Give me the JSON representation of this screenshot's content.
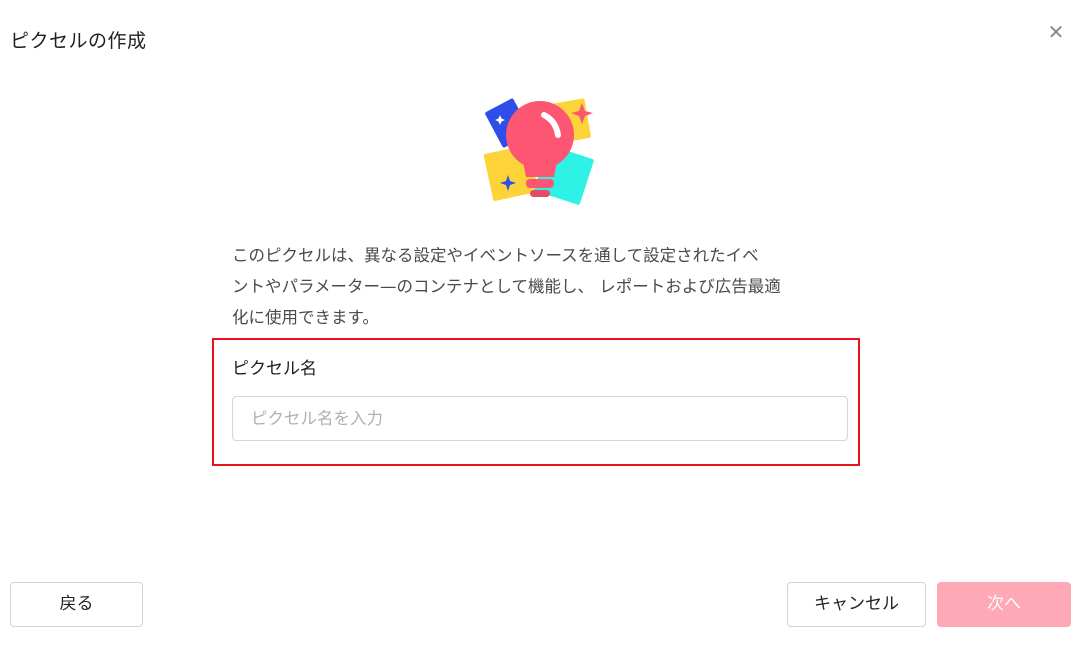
{
  "dialog": {
    "title": "ピクセルの作成",
    "close_icon": "close-icon"
  },
  "illustration": {
    "icon": "lightbulb-illustration",
    "colors": {
      "bulb": "#fd5672",
      "blue_card": "#2f4ee8",
      "yellow_card": "#fdd33a",
      "cyan_card": "#2ff2e6",
      "star": "#fd5672"
    }
  },
  "description": {
    "line1": "このピクセルは、異なる設定やイベントソースを通して設定されたイベ",
    "line2": "ントやパラメーター—のコンテナとして機能し、 レポートおよび広告最適",
    "line3": "化に使用できます。"
  },
  "form": {
    "label": "ピクセル名",
    "input_value": "",
    "input_placeholder": "ピクセル名を入力"
  },
  "footer": {
    "back_label": "戻る",
    "cancel_label": "キャンセル",
    "next_label": "次へ"
  },
  "colors": {
    "highlight_border": "#e8141a",
    "next_button_disabled": "#ffa8b6"
  }
}
